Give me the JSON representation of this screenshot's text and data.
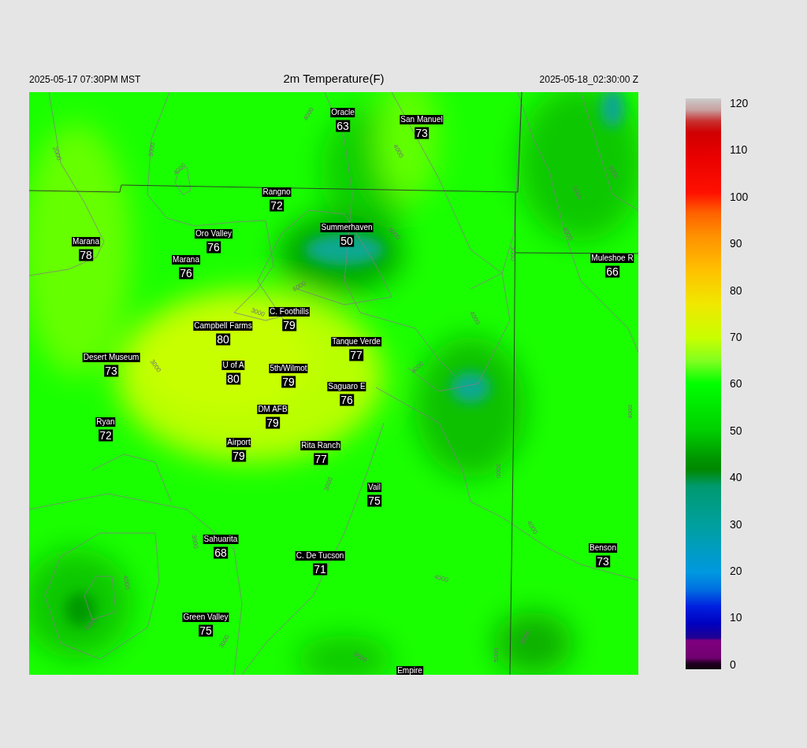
{
  "header": {
    "local_time": "2025-05-17 07:30PM MST",
    "title": "2m Temperature(F)",
    "valid_time": "2025-05-18_02:30:00 Z"
  },
  "map": {
    "stations": [
      {
        "name": "Oracle",
        "value": "63"
      },
      {
        "name": "San Manuel",
        "value": "73"
      },
      {
        "name": "Rangno",
        "value": "72"
      },
      {
        "name": "Summerhaven",
        "value": "50"
      },
      {
        "name": "Marana",
        "value": "78"
      },
      {
        "name": "Oro Valley",
        "value": "76"
      },
      {
        "name": "Marana",
        "value": "76"
      },
      {
        "name": "Muleshoe R",
        "value": "66"
      },
      {
        "name": "C. Foothills",
        "value": "79"
      },
      {
        "name": "Campbell Farms",
        "value": "80"
      },
      {
        "name": "Tanque Verde",
        "value": "77"
      },
      {
        "name": "Desert Museum",
        "value": "73"
      },
      {
        "name": "U of A",
        "value": "80"
      },
      {
        "name": "5th/Wilmot",
        "value": "79"
      },
      {
        "name": "Saguaro E",
        "value": "76"
      },
      {
        "name": "DM AFB",
        "value": "79"
      },
      {
        "name": "Ryan",
        "value": "72"
      },
      {
        "name": "Airport",
        "value": "79"
      },
      {
        "name": "Rita Ranch",
        "value": "77"
      },
      {
        "name": "Vail",
        "value": "75"
      },
      {
        "name": "Sahuarita",
        "value": "68"
      },
      {
        "name": "Benson",
        "value": "73"
      },
      {
        "name": "C. De Tucson",
        "value": "71"
      },
      {
        "name": "Green Valley",
        "value": "75"
      },
      {
        "name": "Empire"
      }
    ],
    "contour_labels": [
      "2000",
      "3000",
      "4000",
      "4000",
      "4000",
      "5000",
      "3000",
      "6000",
      "5000",
      "4000",
      "4000",
      "4000",
      "6000",
      "3000",
      "3000",
      "3000",
      "3000",
      "4000",
      "5000",
      "3000",
      "5000",
      "4000",
      "4000",
      "4000",
      "5000",
      "5000",
      "6000"
    ]
  },
  "colorbar": {
    "ticks": [
      "120",
      "110",
      "100",
      "90",
      "80",
      "70",
      "60",
      "50",
      "40",
      "30",
      "20",
      "10",
      "0"
    ]
  }
}
